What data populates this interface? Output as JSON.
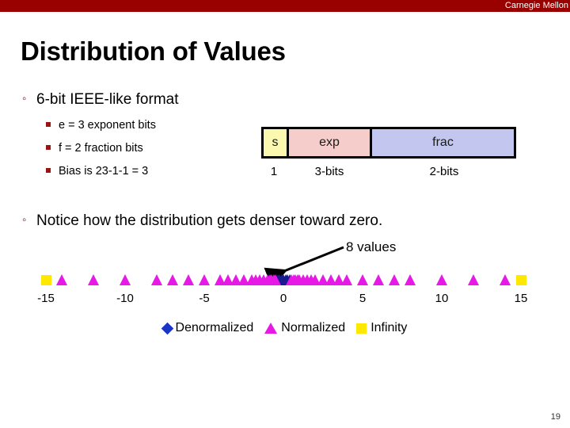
{
  "header": {
    "brand": "Carnegie Mellon",
    "bar_color": "#990000"
  },
  "title": "Distribution of Values",
  "bullets": [
    {
      "marker": "circle-hollow",
      "text": "6-bit IEEE-like format",
      "sub": [
        "e = 3 exponent bits",
        "f = 2 fraction bits",
        "Bias is 23-1-1 = 3"
      ]
    },
    {
      "marker": "circle-hollow",
      "text": "Notice how the distribution gets denser toward zero."
    }
  ],
  "bitfield": {
    "cells": [
      {
        "label": "s",
        "width_label": "1",
        "color": "#fbf8b0"
      },
      {
        "label": "exp",
        "width_label": "3-bits",
        "color": "#f5cecb"
      },
      {
        "label": "frac",
        "width_label": "2-bits",
        "color": "#c3c6ee"
      }
    ]
  },
  "annotation": {
    "text": "8 values"
  },
  "legend": [
    {
      "label": "Denormalized",
      "symbol": "diamond",
      "color": "#1b34c8"
    },
    {
      "label": "Normalized",
      "symbol": "triangle",
      "color": "#e619e6"
    },
    {
      "label": "Infinity",
      "symbol": "square",
      "color": "#ffe800"
    }
  ],
  "page_number": "19",
  "chart_data": {
    "type": "scatter",
    "title": "Distribution of Values",
    "xlabel": "",
    "ylabel": "",
    "xlim": [
      -16,
      16
    ],
    "grid": false,
    "legend_position": "bottom-center",
    "tick_values": [
      -15,
      -10,
      -5,
      0,
      5,
      10,
      15
    ],
    "tick_labels": [
      "-15",
      "-10",
      "-5",
      "0",
      "5",
      "10",
      "15"
    ],
    "series": [
      {
        "name": "Infinity",
        "symbol": "square",
        "color": "#ffe800",
        "x": [
          -15,
          15
        ]
      },
      {
        "name": "Denormalized",
        "symbol": "triangle",
        "color": "#1b1b8f",
        "x": [
          -0.375,
          -0.25,
          -0.125,
          0,
          0.125,
          0.25,
          0.375
        ]
      },
      {
        "name": "Normalized",
        "symbol": "triangle",
        "color": "#e619e6",
        "x": [
          -14,
          -12,
          -10,
          -8,
          -7,
          -6,
          -5,
          -4,
          -3.5,
          -3,
          -2.5,
          -2,
          -1.75,
          -1.5,
          -1.25,
          -1,
          -0.875,
          -0.75,
          -0.625,
          -0.5,
          0.5,
          0.625,
          0.75,
          0.875,
          1,
          1.25,
          1.5,
          1.75,
          2,
          2.5,
          3,
          3.5,
          4,
          5,
          6,
          7,
          8,
          10,
          12,
          14
        ]
      }
    ],
    "annotations": [
      {
        "text": "8 values",
        "points_to": 0.0
      }
    ]
  }
}
